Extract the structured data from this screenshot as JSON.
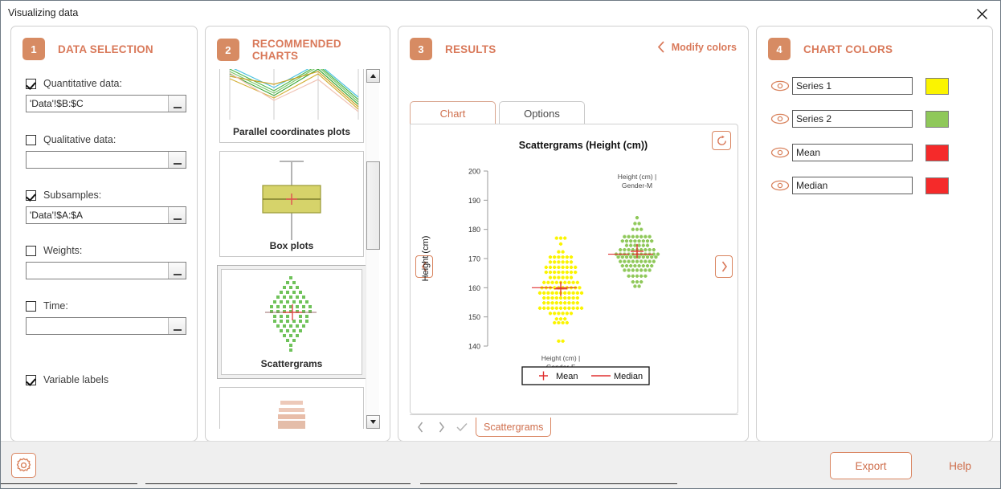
{
  "window": {
    "title": "Visualizing data",
    "close_icon": "close-icon"
  },
  "data_selection": {
    "step": "1",
    "title": "DATA SELECTION",
    "fields": [
      {
        "label": "Quantitative data:",
        "checked": true,
        "value": "'Data'!$B:$C",
        "placeholder": ""
      },
      {
        "label": "Qualitative data:",
        "checked": false,
        "value": "",
        "placeholder": ""
      },
      {
        "label": "Subsamples:",
        "checked": true,
        "value": "'Data'!$A:$A",
        "placeholder": ""
      },
      {
        "label": "Weights:",
        "checked": false,
        "value": "",
        "placeholder": ""
      },
      {
        "label": "Time:",
        "checked": false,
        "value": "",
        "placeholder": ""
      }
    ],
    "variable_labels": {
      "label": "Variable labels",
      "checked": true
    }
  },
  "recommended_charts": {
    "step": "2",
    "title": "RECOMMENDED CHARTS",
    "items": [
      {
        "label": "Parallel coordinates plots",
        "selected": false
      },
      {
        "label": "Box plots",
        "selected": false
      },
      {
        "label": "Scattergrams",
        "selected": true
      },
      {
        "label": "",
        "selected": false
      }
    ],
    "scroll": {
      "up_icon": "scroll-up-icon",
      "down_icon": "scroll-down-icon"
    }
  },
  "results": {
    "step": "3",
    "title": "RESULTS",
    "modify_colors": "Modify colors",
    "tabs": [
      {
        "label": "Chart",
        "active": true
      },
      {
        "label": "Options",
        "active": false
      }
    ],
    "refresh_icon": "refresh-icon",
    "prev_icon": "chevron-left-icon",
    "next_icon": "chevron-right-icon",
    "footer": {
      "prev": "chevron-left-icon",
      "next": "chevron-right-icon",
      "check": "check-icon",
      "tab_label": "Scattergrams"
    }
  },
  "chart_colors": {
    "step": "4",
    "title": "CHART COLORS",
    "rows": [
      {
        "name": "Series 1",
        "color": "#fbf400",
        "eye": "eye-icon"
      },
      {
        "name": "Series 2",
        "color": "#8fc85a",
        "eye": "eye-icon"
      },
      {
        "name": "Mean",
        "color": "#f52a2a",
        "eye": "eye-icon"
      },
      {
        "name": "Median",
        "color": "#f52a2a",
        "eye": "eye-icon"
      }
    ]
  },
  "footer_bar": {
    "settings_icon": "gear-icon",
    "export": "Export",
    "help": "Help"
  },
  "chart_data": {
    "type": "scatter",
    "title": "Scattergrams (Height (cm))",
    "xlabel": "",
    "ylabel": "Height (cm)",
    "ylim": [
      140,
      200
    ],
    "yticks": [
      140,
      150,
      160,
      170,
      180,
      190,
      200
    ],
    "grid": false,
    "legend": {
      "position": "bottom",
      "entries": [
        "Mean",
        "Median"
      ]
    },
    "legend_markers": {
      "mean": "+",
      "median": "line"
    },
    "categories": [
      "Height (cm) | Gender-F",
      "Height (cm) | Gender-M"
    ],
    "series": [
      {
        "name": "Series 1",
        "category": "Height (cm) | Gender-F",
        "color": "#fbf400",
        "mean": 159.6,
        "median": 160.0,
        "bins": [
          {
            "value": 141.7,
            "count": 2
          },
          {
            "value": 148.0,
            "count": 4
          },
          {
            "value": 149.3,
            "count": 3
          },
          {
            "value": 151.2,
            "count": 6
          },
          {
            "value": 153.0,
            "count": 11
          },
          {
            "value": 154.8,
            "count": 9
          },
          {
            "value": 156.5,
            "count": 9
          },
          {
            "value": 158.2,
            "count": 11
          },
          {
            "value": 160.0,
            "count": 10
          },
          {
            "value": 161.8,
            "count": 9
          },
          {
            "value": 163.5,
            "count": 6
          },
          {
            "value": 165.3,
            "count": 8
          },
          {
            "value": 167.0,
            "count": 8
          },
          {
            "value": 168.8,
            "count": 6
          },
          {
            "value": 170.5,
            "count": 6
          },
          {
            "value": 172.3,
            "count": 2
          },
          {
            "value": 175.0,
            "count": 1
          },
          {
            "value": 177.0,
            "count": 3
          }
        ]
      },
      {
        "name": "Series 2",
        "category": "Height (cm) | Gender-M",
        "color": "#8fc85a",
        "mean": 172.5,
        "median": 171.5,
        "bins": [
          {
            "value": 160.5,
            "count": 2
          },
          {
            "value": 162.0,
            "count": 3
          },
          {
            "value": 164.0,
            "count": 5
          },
          {
            "value": 166.0,
            "count": 7
          },
          {
            "value": 167.5,
            "count": 8
          },
          {
            "value": 169.0,
            "count": 9
          },
          {
            "value": 170.5,
            "count": 10
          },
          {
            "value": 171.5,
            "count": 11
          },
          {
            "value": 173.0,
            "count": 9
          },
          {
            "value": 174.5,
            "count": 6
          },
          {
            "value": 176.0,
            "count": 8
          },
          {
            "value": 177.5,
            "count": 7
          },
          {
            "value": 180.0,
            "count": 3
          },
          {
            "value": 182.0,
            "count": 2
          },
          {
            "value": 184.0,
            "count": 1
          }
        ]
      }
    ]
  }
}
